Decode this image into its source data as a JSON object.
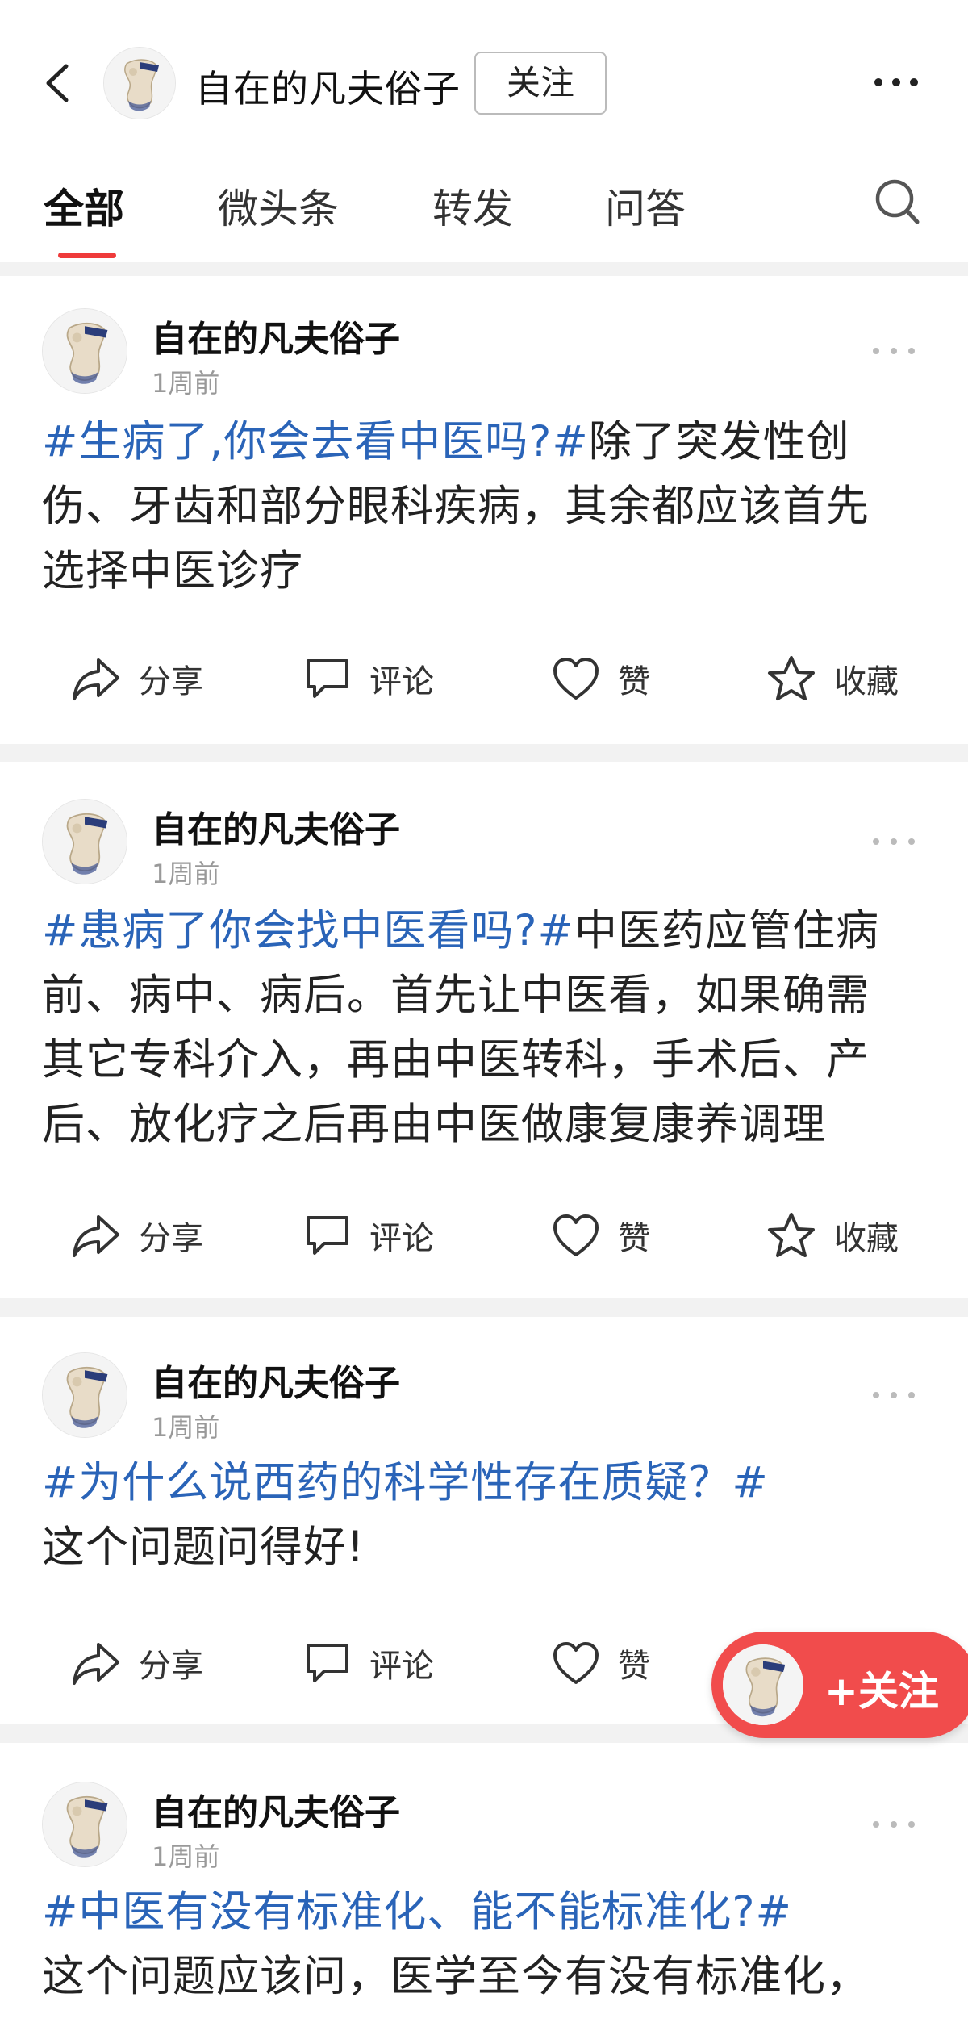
{
  "header": {
    "author_name": "自在的凡夫俗子",
    "follow_label": "关注"
  },
  "tabs": [
    {
      "label": "全部",
      "active": true
    },
    {
      "label": "微头条",
      "active": false
    },
    {
      "label": "转发",
      "active": false
    },
    {
      "label": "问答",
      "active": false
    }
  ],
  "posts": [
    {
      "author": "自在的凡夫俗子",
      "time": "1周前",
      "topic": "#生病了,你会去看中医吗?#",
      "lines": [
        "除了突发性创",
        "伤、牙齿和部分眼科疾病，其余都应该首先",
        "选择中医诊疗"
      ],
      "actions": {
        "share": "分享",
        "comment": "评论",
        "like": "赞",
        "collect": "收藏"
      }
    },
    {
      "author": "自在的凡夫俗子",
      "time": "1周前",
      "topic": "#患病了你会找中医看吗?#",
      "lines": [
        "中医药应管住病",
        "前、病中、病后。首先让中医看，如果确需",
        "其它专科介入，再由中医转科，手术后、产",
        "后、放化疗之后再由中医做康复康养调理"
      ],
      "actions": {
        "share": "分享",
        "comment": "评论",
        "like": "赞",
        "collect": "收藏"
      }
    },
    {
      "author": "自在的凡夫俗子",
      "time": "1周前",
      "topic": "#为什么说西药的科学性存在质疑？#",
      "lines": [
        "",
        "这个问题问得好!"
      ],
      "actions": {
        "share": "分享",
        "comment": "评论",
        "like": "赞"
      }
    },
    {
      "author": "自在的凡夫俗子",
      "time": "1周前",
      "topic": "#中医有没有标准化、能不能标准化?#",
      "lines": [
        "",
        "这个问题应该问，医学至今有没有标准化，"
      ]
    }
  ],
  "float_follow": {
    "label": "+关注"
  },
  "colors": {
    "accent": "#ef3b3b",
    "topic": "#2a64b8",
    "float_bg": "#f14c4c"
  }
}
